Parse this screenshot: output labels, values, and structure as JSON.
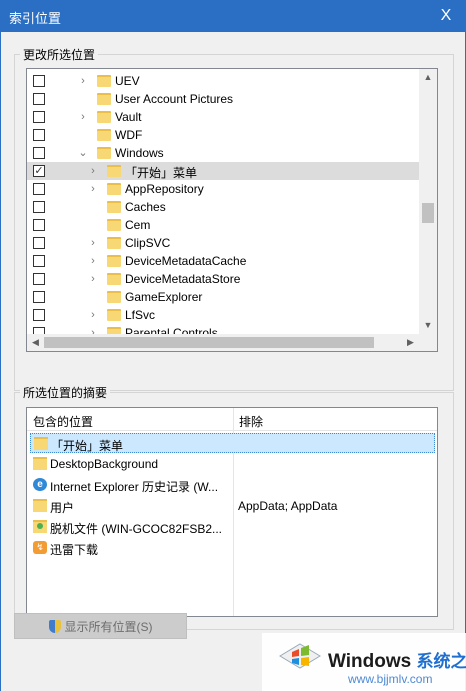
{
  "window": {
    "title": "索引位置",
    "close_label": "X"
  },
  "change_group": {
    "label": "更改所选位置"
  },
  "tree": {
    "rows": [
      {
        "label": "UEV",
        "checked": false,
        "expander": "›",
        "indent": 0
      },
      {
        "label": "User Account Pictures",
        "checked": false,
        "expander": "",
        "indent": 0
      },
      {
        "label": "Vault",
        "checked": false,
        "expander": "›",
        "indent": 0
      },
      {
        "label": "WDF",
        "checked": false,
        "expander": "",
        "indent": 0
      },
      {
        "label": "Windows",
        "checked": false,
        "expander": "⌄",
        "indent": 0
      },
      {
        "label": "「开始」菜单",
        "checked": true,
        "expander": "›",
        "indent": 1,
        "selected": true
      },
      {
        "label": "AppRepository",
        "checked": false,
        "expander": "›",
        "indent": 1
      },
      {
        "label": "Caches",
        "checked": false,
        "expander": "",
        "indent": 1
      },
      {
        "label": "Cem",
        "checked": false,
        "expander": "",
        "indent": 1
      },
      {
        "label": "ClipSVC",
        "checked": false,
        "expander": "›",
        "indent": 1
      },
      {
        "label": "DeviceMetadataCache",
        "checked": false,
        "expander": "›",
        "indent": 1
      },
      {
        "label": "DeviceMetadataStore",
        "checked": false,
        "expander": "›",
        "indent": 1
      },
      {
        "label": "GameExplorer",
        "checked": false,
        "expander": "",
        "indent": 1
      },
      {
        "label": "LfSvc",
        "checked": false,
        "expander": "›",
        "indent": 1
      },
      {
        "label": "Parental Controls",
        "checked": false,
        "expander": "›",
        "indent": 1
      }
    ]
  },
  "summary_group": {
    "label": "所选位置的摘要"
  },
  "summary": {
    "col_included": "包含的位置",
    "col_excluded": "排除",
    "rows": [
      {
        "name": "「开始」菜单",
        "exclude": "",
        "icon": "folder-icon",
        "selected": true
      },
      {
        "name": "DesktopBackground",
        "exclude": "",
        "icon": "folder-icon"
      },
      {
        "name": "Internet Explorer 历史记录 (W...",
        "exclude": "",
        "icon": "ie-icon"
      },
      {
        "name": "用户",
        "exclude": "AppData; AppData",
        "icon": "folder-icon"
      },
      {
        "name": "脱机文件 (WIN-GCOC82FSB2...",
        "exclude": "",
        "icon": "offline-files-icon"
      },
      {
        "name": "迅雷下载",
        "exclude": "",
        "icon": "xunlei-icon"
      }
    ]
  },
  "buttons": {
    "show_all": "显示所有位置(S)"
  },
  "watermark": {
    "brand": "Windows",
    "brand_zh": "系统之家",
    "url": "www.bjjmlv.com"
  },
  "colors": {
    "titlebar": "#2b6fc4",
    "selection": "#cce8ff",
    "folder": "#f8d775"
  }
}
